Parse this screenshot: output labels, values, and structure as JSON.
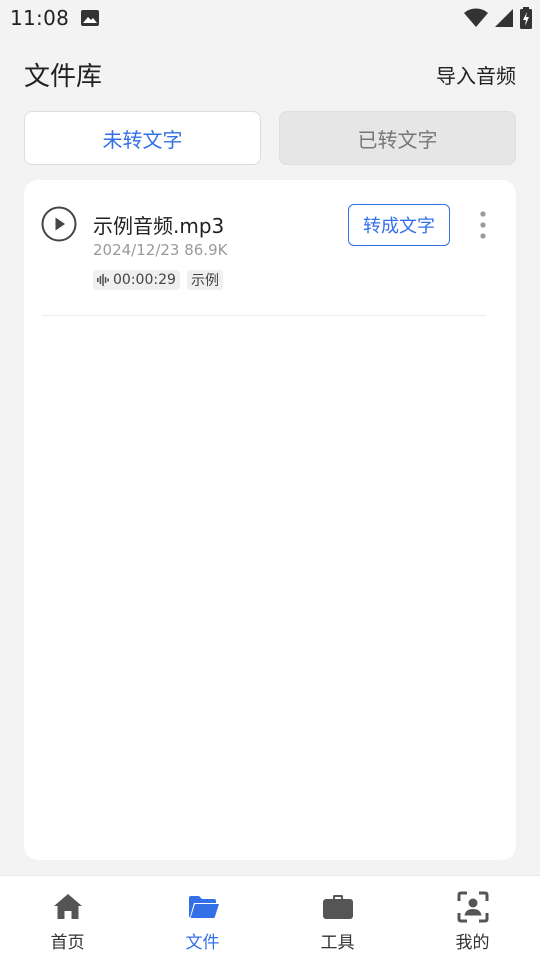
{
  "status_bar": {
    "time": "11:08",
    "icons": [
      "image-icon",
      "wifi-icon",
      "signal-icon",
      "battery-charging-icon"
    ]
  },
  "header": {
    "title": "文件库",
    "import_label": "导入音频"
  },
  "tabs": [
    {
      "label": "未转文字",
      "active": true
    },
    {
      "label": "已转文字",
      "active": false
    }
  ],
  "files": [
    {
      "name": "示例音频.mp3",
      "meta": "2024/12/23 86.9K",
      "duration": "00:00:29",
      "tag": "示例",
      "action_label": "转成文字"
    }
  ],
  "bottom_nav": [
    {
      "label": "首页",
      "icon": "home-icon",
      "active": false
    },
    {
      "label": "文件",
      "icon": "folder-icon",
      "active": true
    },
    {
      "label": "工具",
      "icon": "toolbox-icon",
      "active": false
    },
    {
      "label": "我的",
      "icon": "profile-scan-icon",
      "active": false
    }
  ],
  "colors": {
    "accent": "#3370e8",
    "nav_inactive_icon": "#555555",
    "background": "#f3f3f3"
  }
}
